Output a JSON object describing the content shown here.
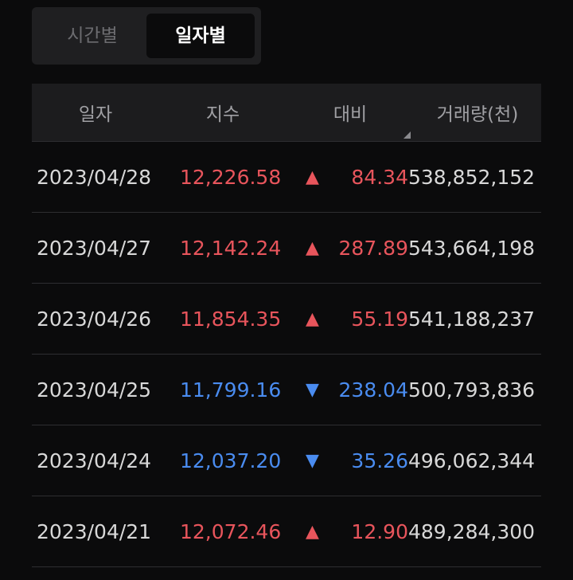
{
  "tabs": [
    {
      "label": "시간별",
      "active": false
    },
    {
      "label": "일자별",
      "active": true
    }
  ],
  "table": {
    "headers": [
      "일자",
      "지수",
      "대비",
      "거래량(천)"
    ],
    "rows": [
      {
        "date": "2023/04/28",
        "index": "12,226.58",
        "arrow": "▲",
        "direction": "up",
        "diff": "84.34",
        "volume": "538,852,152"
      },
      {
        "date": "2023/04/27",
        "index": "12,142.24",
        "arrow": "▲",
        "direction": "up",
        "diff": "287.89",
        "volume": "543,664,198"
      },
      {
        "date": "2023/04/26",
        "index": "11,854.35",
        "arrow": "▲",
        "direction": "up",
        "diff": "55.19",
        "volume": "541,188,237"
      },
      {
        "date": "2023/04/25",
        "index": "11,799.16",
        "arrow": "▼",
        "direction": "down",
        "diff": "238.04",
        "volume": "500,793,836"
      },
      {
        "date": "2023/04/24",
        "index": "12,037.20",
        "arrow": "▼",
        "direction": "down",
        "diff": "35.26",
        "volume": "496,062,344"
      },
      {
        "date": "2023/04/21",
        "index": "12,072.46",
        "arrow": "▲",
        "direction": "up",
        "diff": "12.90",
        "volume": "489,284,300"
      }
    ]
  },
  "colors": {
    "up": "#e8555c",
    "down": "#4a8cf0",
    "background": "#0b0b0c"
  }
}
